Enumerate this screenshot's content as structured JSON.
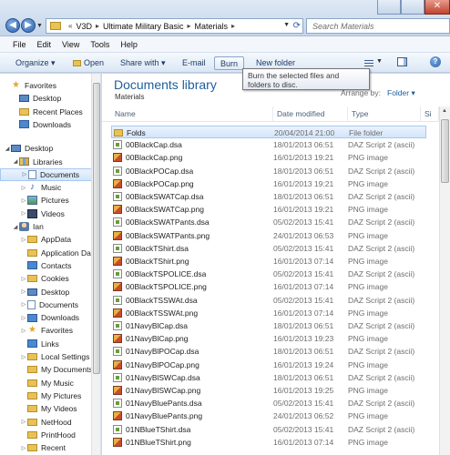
{
  "address": {
    "recent_arrow": "«",
    "crumbs": [
      "V3D",
      "Ultimate Military Basic",
      "Materials"
    ],
    "separator": "▸"
  },
  "search": {
    "placeholder": "Search Materials"
  },
  "menu": [
    "File",
    "Edit",
    "View",
    "Tools",
    "Help"
  ],
  "toolbar": {
    "organize": "Organize ▾",
    "open": "Open",
    "share_with": "Share with ▾",
    "email": "E-mail",
    "burn": "Burn",
    "new_folder": "New folder"
  },
  "tooltip": "Burn the selected files and folders to disc.",
  "library": {
    "title": "Documents library",
    "subtitle": "Materials",
    "arrange_label": "Arrange by:",
    "arrange_value": "Folder ▾"
  },
  "columns": {
    "name": "Name",
    "date": "Date modified",
    "type": "Type",
    "size": "Si"
  },
  "files": [
    {
      "name": "Folds",
      "date": "20/04/2014 21:00",
      "type": "File folder",
      "kind": "folder"
    },
    {
      "name": "00BlackCap.dsa",
      "date": "18/01/2013 06:51",
      "type": "DAZ Script 2 (ascii)",
      "kind": "dsa"
    },
    {
      "name": "00BlackCap.png",
      "date": "16/01/2013 19:21",
      "type": "PNG image",
      "kind": "png"
    },
    {
      "name": "00BlackPOCap.dsa",
      "date": "18/01/2013 06:51",
      "type": "DAZ Script 2 (ascii)",
      "kind": "dsa"
    },
    {
      "name": "00BlackPOCap.png",
      "date": "16/01/2013 19:21",
      "type": "PNG image",
      "kind": "png"
    },
    {
      "name": "00BlackSWATCap.dsa",
      "date": "18/01/2013 06:51",
      "type": "DAZ Script 2 (ascii)",
      "kind": "dsa"
    },
    {
      "name": "00BlackSWATCap.png",
      "date": "16/01/2013 19:21",
      "type": "PNG image",
      "kind": "png"
    },
    {
      "name": "00BlackSWATPants.dsa",
      "date": "05/02/2013 15:41",
      "type": "DAZ Script 2 (ascii)",
      "kind": "dsa"
    },
    {
      "name": "00BlackSWATPants.png",
      "date": "24/01/2013 06:53",
      "type": "PNG image",
      "kind": "png"
    },
    {
      "name": "00BlackTShirt.dsa",
      "date": "05/02/2013 15:41",
      "type": "DAZ Script 2 (ascii)",
      "kind": "dsa"
    },
    {
      "name": "00BlackTShirt.png",
      "date": "16/01/2013 07:14",
      "type": "PNG image",
      "kind": "png"
    },
    {
      "name": "00BlackTSPOLICE.dsa",
      "date": "05/02/2013 15:41",
      "type": "DAZ Script 2 (ascii)",
      "kind": "dsa"
    },
    {
      "name": "00BlackTSPOLICE.png",
      "date": "16/01/2013 07:14",
      "type": "PNG image",
      "kind": "png"
    },
    {
      "name": "00BlackTSSWAt.dsa",
      "date": "05/02/2013 15:41",
      "type": "DAZ Script 2 (ascii)",
      "kind": "dsa"
    },
    {
      "name": "00BlackTSSWAt.png",
      "date": "16/01/2013 07:14",
      "type": "PNG image",
      "kind": "png"
    },
    {
      "name": "01NavyBlCap.dsa",
      "date": "18/01/2013 06:51",
      "type": "DAZ Script 2 (ascii)",
      "kind": "dsa"
    },
    {
      "name": "01NavyBlCap.png",
      "date": "16/01/2013 19:23",
      "type": "PNG image",
      "kind": "png"
    },
    {
      "name": "01NavyBlPOCap.dsa",
      "date": "18/01/2013 06:51",
      "type": "DAZ Script 2 (ascii)",
      "kind": "dsa"
    },
    {
      "name": "01NavyBlPOCap.png",
      "date": "16/01/2013 19:24",
      "type": "PNG image",
      "kind": "png"
    },
    {
      "name": "01NavyBlSWCap.dsa",
      "date": "18/01/2013 06:51",
      "type": "DAZ Script 2 (ascii)",
      "kind": "dsa"
    },
    {
      "name": "01NavyBlSWCap.png",
      "date": "16/01/2013 19:25",
      "type": "PNG image",
      "kind": "png"
    },
    {
      "name": "01NavyBluePants.dsa",
      "date": "05/02/2013 15:41",
      "type": "DAZ Script 2 (ascii)",
      "kind": "dsa"
    },
    {
      "name": "01NavyBluePants.png",
      "date": "24/01/2013 06:52",
      "type": "PNG image",
      "kind": "png"
    },
    {
      "name": "01NBlueTShirt.dsa",
      "date": "05/02/2013 15:41",
      "type": "DAZ Script 2 (ascii)",
      "kind": "dsa"
    },
    {
      "name": "01NBlueTShirt.png",
      "date": "16/01/2013 07:14",
      "type": "PNG image",
      "kind": "png"
    }
  ],
  "nav": [
    {
      "label": "Favorites",
      "icon": "star-icon",
      "indent": 0,
      "expander": ""
    },
    {
      "label": "Desktop",
      "icon": "desktop-icon",
      "indent": 1,
      "expander": ""
    },
    {
      "label": "Recent Places",
      "icon": "recent-places-icon",
      "indent": 1,
      "expander": ""
    },
    {
      "label": "Downloads",
      "icon": "downloads-icon",
      "indent": 1,
      "expander": ""
    },
    {
      "label": "",
      "icon": "",
      "indent": 0,
      "expander": "",
      "spacer": true
    },
    {
      "label": "Desktop",
      "icon": "desktop-icon",
      "indent": 0,
      "expander": "◢"
    },
    {
      "label": "Libraries",
      "icon": "libraries-icon",
      "indent": 1,
      "expander": "◢"
    },
    {
      "label": "Documents",
      "icon": "documents-icon",
      "indent": 2,
      "expander": "▷",
      "selected": true
    },
    {
      "label": "Music",
      "icon": "music-icon",
      "indent": 2,
      "expander": "▷"
    },
    {
      "label": "Pictures",
      "icon": "pictures-icon",
      "indent": 2,
      "expander": "▷"
    },
    {
      "label": "Videos",
      "icon": "videos-icon",
      "indent": 2,
      "expander": "▷"
    },
    {
      "label": "Ian",
      "icon": "user-icon",
      "indent": 1,
      "expander": "◢"
    },
    {
      "label": "AppData",
      "icon": "folder-icon",
      "indent": 2,
      "expander": "▷"
    },
    {
      "label": "Application Da",
      "icon": "folder-icon",
      "indent": 2,
      "expander": ""
    },
    {
      "label": "Contacts",
      "icon": "contacts-icon",
      "indent": 2,
      "expander": ""
    },
    {
      "label": "Cookies",
      "icon": "folder-icon",
      "indent": 2,
      "expander": "▷"
    },
    {
      "label": "Desktop",
      "icon": "desktop-icon",
      "indent": 2,
      "expander": "▷"
    },
    {
      "label": "Documents",
      "icon": "documents-icon",
      "indent": 2,
      "expander": "▷"
    },
    {
      "label": "Downloads",
      "icon": "downloads-icon",
      "indent": 2,
      "expander": "▷"
    },
    {
      "label": "Favorites",
      "icon": "star-icon",
      "indent": 2,
      "expander": "▷"
    },
    {
      "label": "Links",
      "icon": "links-icon",
      "indent": 2,
      "expander": ""
    },
    {
      "label": "Local Settings",
      "icon": "folder-icon",
      "indent": 2,
      "expander": "▷"
    },
    {
      "label": "My Documents",
      "icon": "folder-icon",
      "indent": 2,
      "expander": ""
    },
    {
      "label": "My Music",
      "icon": "folder-icon",
      "indent": 2,
      "expander": ""
    },
    {
      "label": "My Pictures",
      "icon": "folder-icon",
      "indent": 2,
      "expander": ""
    },
    {
      "label": "My Videos",
      "icon": "folder-icon",
      "indent": 2,
      "expander": ""
    },
    {
      "label": "NetHood",
      "icon": "folder-icon",
      "indent": 2,
      "expander": "▷"
    },
    {
      "label": "PrintHood",
      "icon": "folder-icon",
      "indent": 2,
      "expander": ""
    },
    {
      "label": "Recent",
      "icon": "folder-icon",
      "indent": 2,
      "expander": "▷"
    }
  ]
}
